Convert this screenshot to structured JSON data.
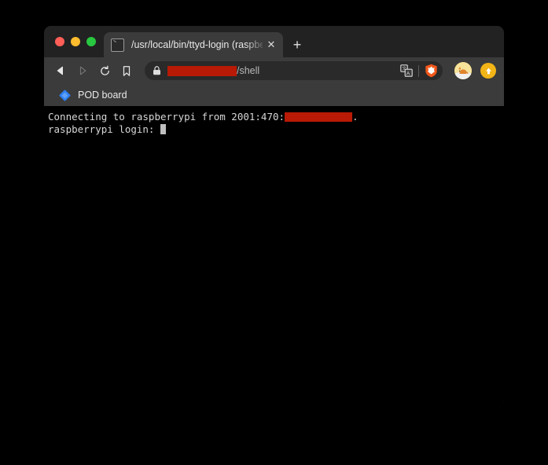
{
  "window": {
    "traffic_lights": [
      {
        "name": "close",
        "color": "#ff5f57"
      },
      {
        "name": "minimize",
        "color": "#febc2e"
      },
      {
        "name": "maximize",
        "color": "#28c840"
      }
    ]
  },
  "tabstrip": {
    "tabs": [
      {
        "title": "/usr/local/bin/ttyd-login (raspberry",
        "favicon": "terminal-icon",
        "close_label": "✕"
      }
    ],
    "new_tab_label": "+"
  },
  "toolbar": {
    "back_label": "Back",
    "forward_label": "Forward",
    "reload_label": "Reload",
    "bookmark_label": "Bookmark this page",
    "url": {
      "lock": "secure-lock",
      "redacted": "",
      "suffix": "/shell"
    },
    "translate_label": "Translate this page",
    "shield_label": "Brave Shields",
    "avatar_label": "Profile",
    "update_label": "Update available"
  },
  "bookmarks": {
    "items": [
      {
        "label": "POD board",
        "icon": "jira-diamond-icon",
        "color": "#2f7ff0"
      }
    ]
  },
  "terminal": {
    "lines": [
      {
        "before": "Connecting to raspberrypi from 2001:470:",
        "redacted": true,
        "after": "."
      },
      {
        "before": "raspberrypi login: ",
        "cursor": true,
        "after": ""
      }
    ],
    "redaction_color": "#b81a05",
    "background": "#000000",
    "foreground": "#d6d6d6"
  }
}
